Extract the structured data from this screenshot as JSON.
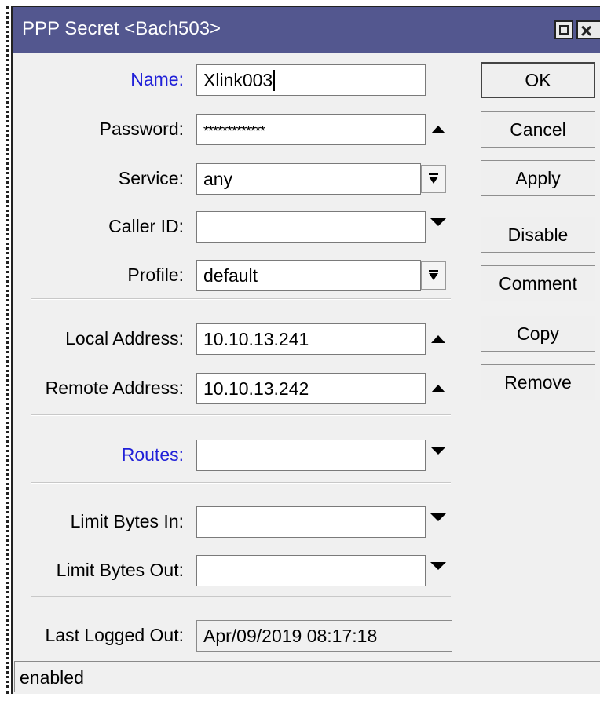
{
  "window": {
    "title": "PPP Secret <Bach503>",
    "title_bar_color": "#53578f",
    "maximize_icon": "maximize-icon",
    "close_icon": "close-icon",
    "close_glyph": "×"
  },
  "form": {
    "name": {
      "label": "Name:",
      "value": "Xlink003"
    },
    "password": {
      "label": "Password:",
      "value": "*************"
    },
    "service": {
      "label": "Service:",
      "value": "any"
    },
    "caller_id": {
      "label": "Caller ID:",
      "value": ""
    },
    "profile": {
      "label": "Profile:",
      "value": "default"
    },
    "local_address": {
      "label": "Local Address:",
      "value": "10.10.13.241"
    },
    "remote_address": {
      "label": "Remote Address:",
      "value": "10.10.13.242"
    },
    "routes": {
      "label": "Routes:",
      "value": ""
    },
    "limit_bytes_in": {
      "label": "Limit Bytes In:",
      "value": ""
    },
    "limit_bytes_out": {
      "label": "Limit Bytes Out:",
      "value": ""
    },
    "last_logged_out": {
      "label": "Last Logged Out:",
      "value": "Apr/09/2019 08:17:18"
    },
    "link_label_color": "#2020d8"
  },
  "buttons": {
    "ok": "OK",
    "cancel": "Cancel",
    "apply": "Apply",
    "disable": "Disable",
    "comment": "Comment",
    "copy": "Copy",
    "remove": "Remove"
  },
  "status": {
    "text": "enabled"
  }
}
